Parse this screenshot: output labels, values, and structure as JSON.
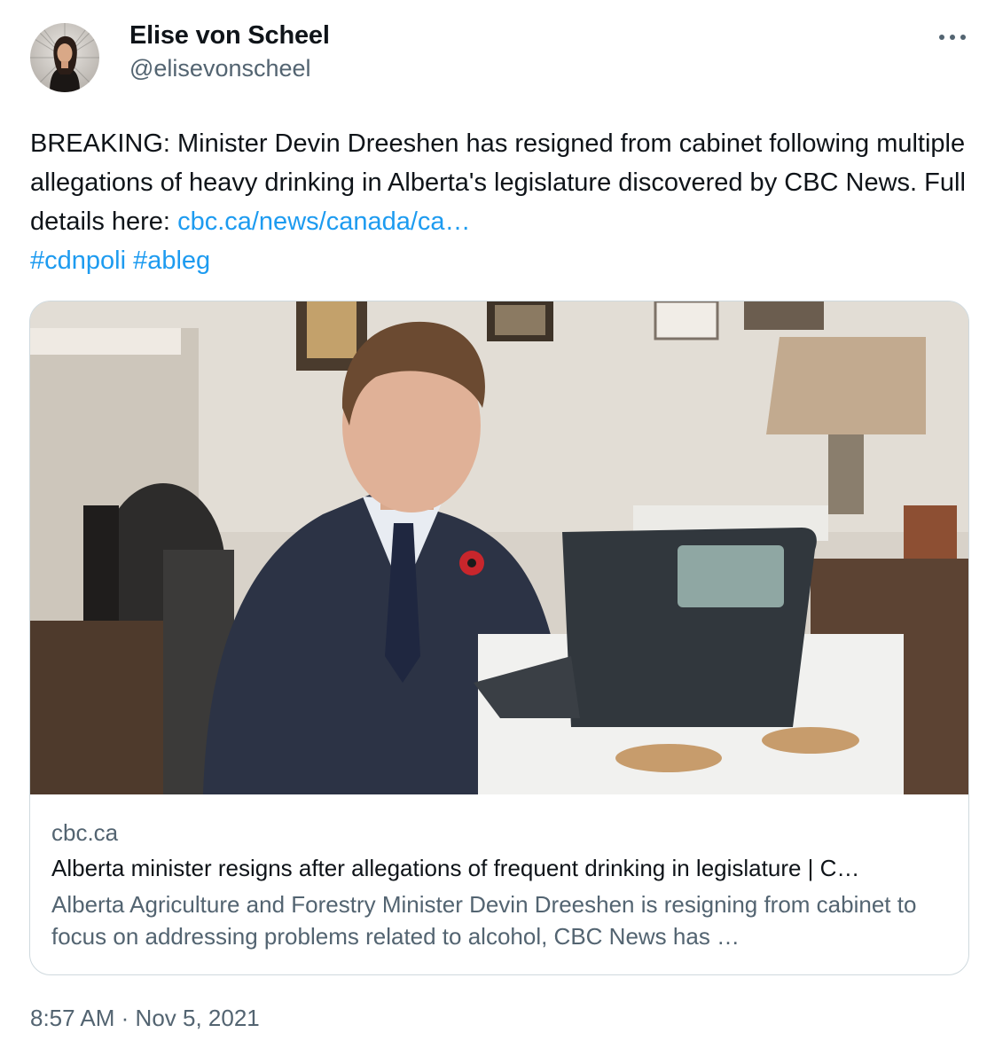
{
  "author": {
    "name": "Elise von Scheel",
    "handle": "@elisevonscheel"
  },
  "tweet": {
    "text_main": "BREAKING: Minister Devin Dreeshen has resigned from cabinet following multiple allegations of heavy drinking in Alberta's legislature discovered by CBC News. Full details here:",
    "link_text": "cbc.ca/news/canada/ca…",
    "hashtags": [
      "#cdnpoli",
      "#ableg"
    ]
  },
  "card": {
    "domain": "cbc.ca",
    "title": "Alberta minister resigns after allegations of frequent drinking in legislature | C…",
    "description": "Alberta Agriculture and Forestry Minister Devin Dreeshen is resigning from cabinet to focus on addressing problems related to alcohol, CBC News has …"
  },
  "meta": {
    "time": "8:57 AM",
    "separator": "·",
    "date": "Nov 5, 2021"
  },
  "icons": {
    "more": "more-horizontal-icon",
    "avatar": "profile-photo"
  },
  "colors": {
    "link": "#1d9bf0",
    "secondary_text": "#536471",
    "primary_text": "#0f1419",
    "border": "#cfd9de"
  }
}
